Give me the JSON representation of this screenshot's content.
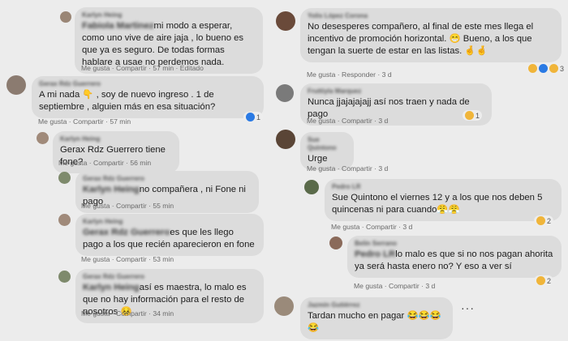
{
  "left": [
    {
      "name": "Karlyn Heing",
      "inline_name": "Fabiola Martinez",
      "text": "mi modo a esperar, como uno vive de aire jaja , lo bueno es que ya es seguro. De todas formas hablare a usae no perdemos nada.",
      "meta": "Me gusta · Compartir · 57 min · Editado"
    },
    {
      "name": "Gerax Rdz Guerrero",
      "text": "A mi nada 👇 , soy de nuevo ingreso . 1 de septiembre , alguien más en esa situación?",
      "meta": "Me gusta · Compartir · 57 min",
      "reaction_count": "1"
    },
    {
      "name": "Karlyn Heing",
      "text": "Gerax Rdz Guerrero tiene fone?",
      "meta": "Me gusta · Compartir · 56 min"
    },
    {
      "name": "Gerax Rdz Guerrero",
      "inline_name": "Karlyn Heing",
      "text": "no compañera , ni Fone ni pago",
      "meta": "Me gusta · Compartir · 55 min"
    },
    {
      "name": "Karlyn Heing",
      "inline_name": "Gerax Rdz Guerrero",
      "text": "es que les llego pago a los que recién aparecieron en fone",
      "meta": "Me gusta · Compartir · 53 min"
    },
    {
      "name": "Gerax Rdz Guerrero",
      "inline_name": "Karlyn Heing",
      "text": "así es maestra, lo malo es que no hay información para el resto de nosotros 😣",
      "meta": "Me gusta · Compartir · 34 min"
    }
  ],
  "right": [
    {
      "name": "Yolis López Corona",
      "text": "No desesperes compañero, al final de este mes llega el incentivo de promoción horizontal. 😁 Bueno, a los que tengan la suerte de estar en las listas. 🤞🤞",
      "meta": "Me gusta · Responder · 3 d",
      "reaction_count": "3"
    },
    {
      "name": "Fruttiyla Marquez",
      "text": "Nunca jjajajajajj así nos traen y nada de pago",
      "meta": "Me gusta · Compartir · 3 d",
      "reaction_count": "1"
    },
    {
      "name": "Sue Quintono",
      "text": "Urge",
      "meta": "Me gusta · Compartir · 3 d"
    },
    {
      "name": "Pedro LR",
      "text": "Sue Quintono el viernes 12 y a los que nos deben 5 quincenas ni para cuando😤😤",
      "meta": "Me gusta · Compartir · 3 d",
      "reaction_count": "2"
    },
    {
      "name": "Belín Serrano",
      "inline_name": "Pedro LR",
      "text": "lo malo es que si no nos pagan ahorita ya será hasta enero no? Y eso a ver sí",
      "meta": "Me gusta · Compartir · 3 d",
      "reaction_count": "2"
    },
    {
      "name": "Jazmín Gutiérrez",
      "text": "Tardan mucho en pagar 😂😂😂😂",
      "more": "···"
    }
  ]
}
